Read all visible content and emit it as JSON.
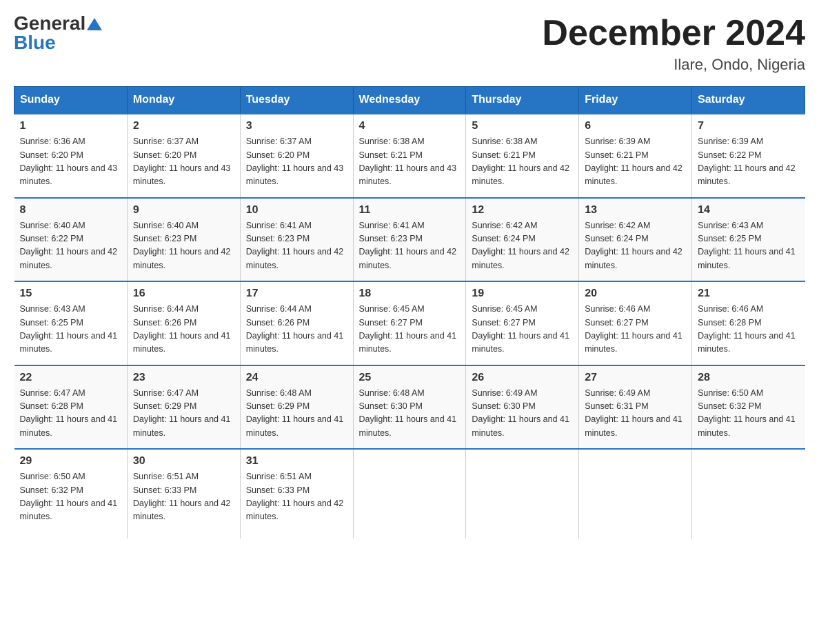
{
  "header": {
    "logo_general": "General",
    "logo_blue": "Blue",
    "month_title": "December 2024",
    "location": "Ilare, Ondo, Nigeria"
  },
  "weekdays": [
    "Sunday",
    "Monday",
    "Tuesday",
    "Wednesday",
    "Thursday",
    "Friday",
    "Saturday"
  ],
  "weeks": [
    [
      {
        "day": "1",
        "sunrise": "6:36 AM",
        "sunset": "6:20 PM",
        "daylight": "11 hours and 43 minutes."
      },
      {
        "day": "2",
        "sunrise": "6:37 AM",
        "sunset": "6:20 PM",
        "daylight": "11 hours and 43 minutes."
      },
      {
        "day": "3",
        "sunrise": "6:37 AM",
        "sunset": "6:20 PM",
        "daylight": "11 hours and 43 minutes."
      },
      {
        "day": "4",
        "sunrise": "6:38 AM",
        "sunset": "6:21 PM",
        "daylight": "11 hours and 43 minutes."
      },
      {
        "day": "5",
        "sunrise": "6:38 AM",
        "sunset": "6:21 PM",
        "daylight": "11 hours and 42 minutes."
      },
      {
        "day": "6",
        "sunrise": "6:39 AM",
        "sunset": "6:21 PM",
        "daylight": "11 hours and 42 minutes."
      },
      {
        "day": "7",
        "sunrise": "6:39 AM",
        "sunset": "6:22 PM",
        "daylight": "11 hours and 42 minutes."
      }
    ],
    [
      {
        "day": "8",
        "sunrise": "6:40 AM",
        "sunset": "6:22 PM",
        "daylight": "11 hours and 42 minutes."
      },
      {
        "day": "9",
        "sunrise": "6:40 AM",
        "sunset": "6:23 PM",
        "daylight": "11 hours and 42 minutes."
      },
      {
        "day": "10",
        "sunrise": "6:41 AM",
        "sunset": "6:23 PM",
        "daylight": "11 hours and 42 minutes."
      },
      {
        "day": "11",
        "sunrise": "6:41 AM",
        "sunset": "6:23 PM",
        "daylight": "11 hours and 42 minutes."
      },
      {
        "day": "12",
        "sunrise": "6:42 AM",
        "sunset": "6:24 PM",
        "daylight": "11 hours and 42 minutes."
      },
      {
        "day": "13",
        "sunrise": "6:42 AM",
        "sunset": "6:24 PM",
        "daylight": "11 hours and 42 minutes."
      },
      {
        "day": "14",
        "sunrise": "6:43 AM",
        "sunset": "6:25 PM",
        "daylight": "11 hours and 41 minutes."
      }
    ],
    [
      {
        "day": "15",
        "sunrise": "6:43 AM",
        "sunset": "6:25 PM",
        "daylight": "11 hours and 41 minutes."
      },
      {
        "day": "16",
        "sunrise": "6:44 AM",
        "sunset": "6:26 PM",
        "daylight": "11 hours and 41 minutes."
      },
      {
        "day": "17",
        "sunrise": "6:44 AM",
        "sunset": "6:26 PM",
        "daylight": "11 hours and 41 minutes."
      },
      {
        "day": "18",
        "sunrise": "6:45 AM",
        "sunset": "6:27 PM",
        "daylight": "11 hours and 41 minutes."
      },
      {
        "day": "19",
        "sunrise": "6:45 AM",
        "sunset": "6:27 PM",
        "daylight": "11 hours and 41 minutes."
      },
      {
        "day": "20",
        "sunrise": "6:46 AM",
        "sunset": "6:27 PM",
        "daylight": "11 hours and 41 minutes."
      },
      {
        "day": "21",
        "sunrise": "6:46 AM",
        "sunset": "6:28 PM",
        "daylight": "11 hours and 41 minutes."
      }
    ],
    [
      {
        "day": "22",
        "sunrise": "6:47 AM",
        "sunset": "6:28 PM",
        "daylight": "11 hours and 41 minutes."
      },
      {
        "day": "23",
        "sunrise": "6:47 AM",
        "sunset": "6:29 PM",
        "daylight": "11 hours and 41 minutes."
      },
      {
        "day": "24",
        "sunrise": "6:48 AM",
        "sunset": "6:29 PM",
        "daylight": "11 hours and 41 minutes."
      },
      {
        "day": "25",
        "sunrise": "6:48 AM",
        "sunset": "6:30 PM",
        "daylight": "11 hours and 41 minutes."
      },
      {
        "day": "26",
        "sunrise": "6:49 AM",
        "sunset": "6:30 PM",
        "daylight": "11 hours and 41 minutes."
      },
      {
        "day": "27",
        "sunrise": "6:49 AM",
        "sunset": "6:31 PM",
        "daylight": "11 hours and 41 minutes."
      },
      {
        "day": "28",
        "sunrise": "6:50 AM",
        "sunset": "6:32 PM",
        "daylight": "11 hours and 41 minutes."
      }
    ],
    [
      {
        "day": "29",
        "sunrise": "6:50 AM",
        "sunset": "6:32 PM",
        "daylight": "11 hours and 41 minutes."
      },
      {
        "day": "30",
        "sunrise": "6:51 AM",
        "sunset": "6:33 PM",
        "daylight": "11 hours and 42 minutes."
      },
      {
        "day": "31",
        "sunrise": "6:51 AM",
        "sunset": "6:33 PM",
        "daylight": "11 hours and 42 minutes."
      },
      null,
      null,
      null,
      null
    ]
  ]
}
